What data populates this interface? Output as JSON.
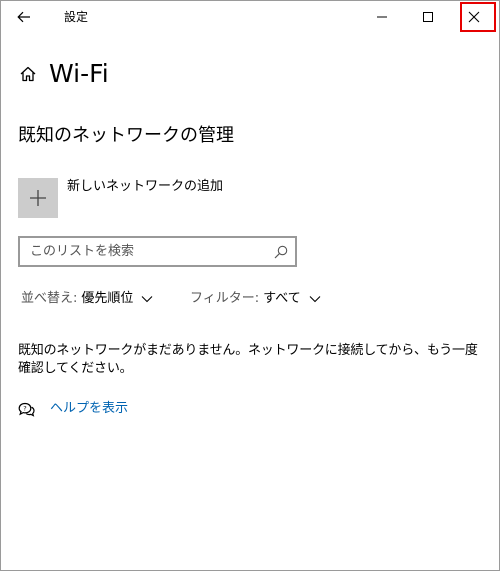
{
  "titlebar": {
    "title": "設定"
  },
  "header": {
    "title": "Wi-Fi",
    "icon": "home-icon"
  },
  "section": {
    "title": "既知のネットワークの管理"
  },
  "add_network": {
    "label": "新しいネットワークの追加",
    "icon": "plus-icon"
  },
  "search": {
    "placeholder": "このリストを検索",
    "value": ""
  },
  "sort": {
    "label": "並べ替え:",
    "value": "優先順位"
  },
  "filter": {
    "label": "フィルター:",
    "value": "すべて"
  },
  "message": "既知のネットワークがまだありません。ネットワークに接続してから、もう一度確認してください。",
  "help": {
    "label": "ヘルプを表示"
  },
  "colors": {
    "accent_link": "#0063b1",
    "highlight_border": "#e60000",
    "tile_bg": "#cccccc"
  }
}
